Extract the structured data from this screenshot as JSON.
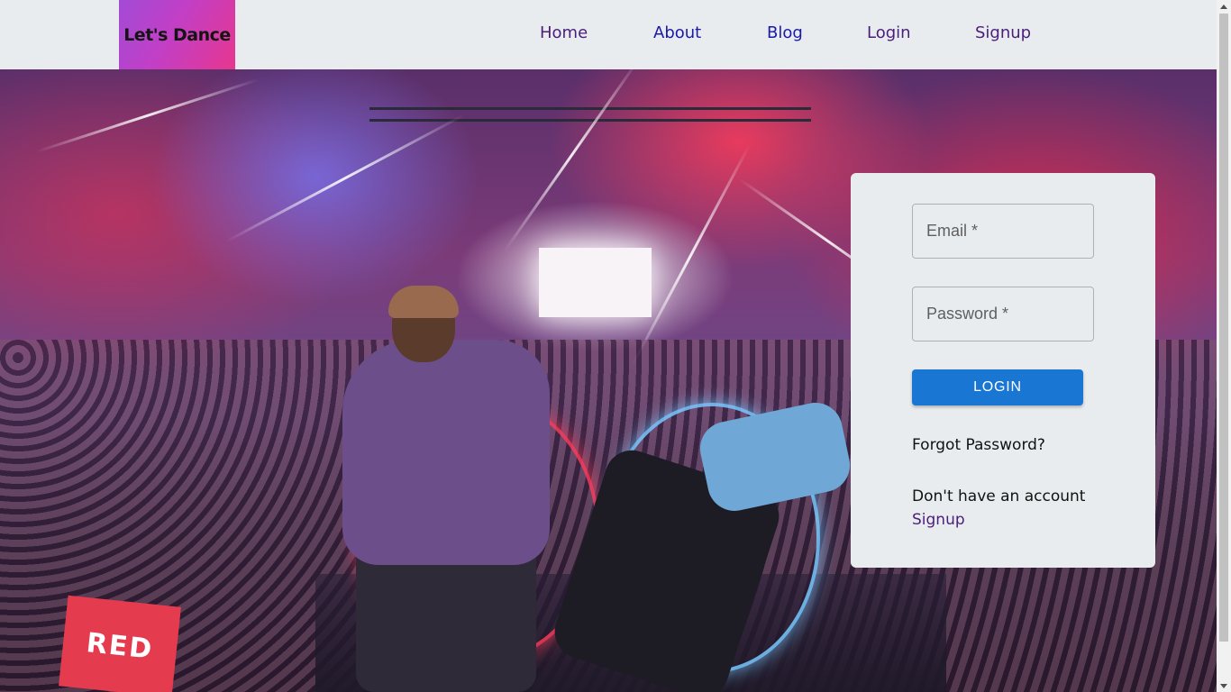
{
  "navbar": {
    "logo_text": "Let's Dance",
    "links": {
      "home": "Home",
      "about": "About",
      "blog": "Blog",
      "login": "Login",
      "signup": "Signup"
    }
  },
  "hero": {
    "sign_text": "RED"
  },
  "login_form": {
    "email_label": "Email *",
    "password_label": "Password *",
    "login_button": "LOGIN",
    "forgot_password": "Forgot Password?",
    "no_account_text": "Don't have an account",
    "signup_link": "Signup"
  },
  "colors": {
    "background": "#e9ecef",
    "logo_gradient_start": "#a24bd6",
    "logo_gradient_end": "#e7368f",
    "primary_button": "#1976d2",
    "link_purple": "#4b1e7a",
    "link_blue": "#1a1aa6"
  }
}
